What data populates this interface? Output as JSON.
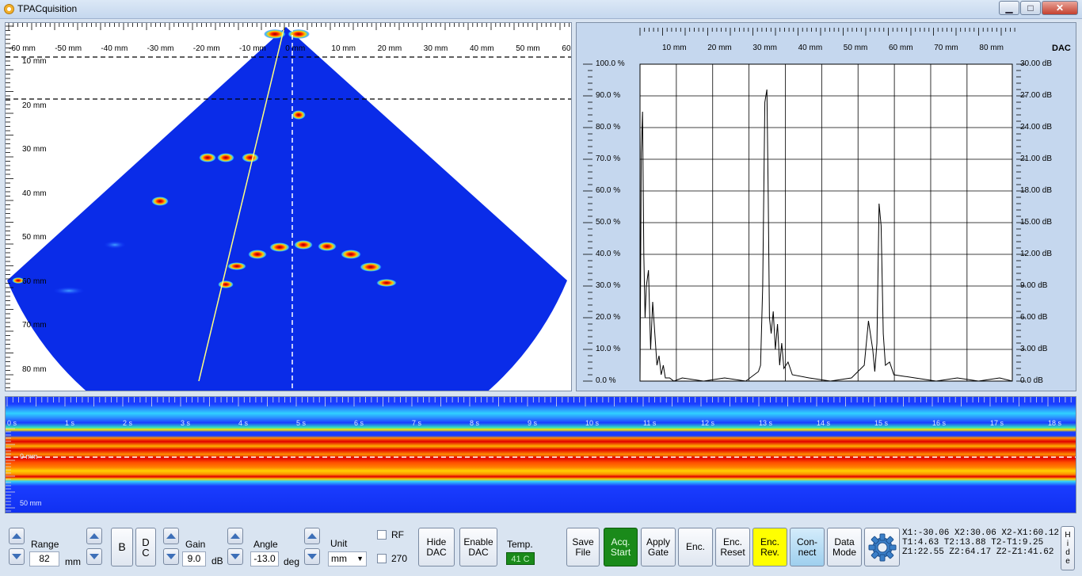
{
  "window": {
    "title": "TPACquisition",
    "minimize": "▁",
    "maximize": "□",
    "close": "✕",
    "icon": "app-icon"
  },
  "bscan": {
    "top_ticks": [
      "-60 mm",
      "-50 mm",
      "-40 mm",
      "-30 mm",
      "-20 mm",
      "-10 mm",
      "0 mm",
      "10 mm",
      "20 mm",
      "30 mm",
      "40 mm",
      "50 mm",
      "60 mm"
    ],
    "depth_ticks": [
      "10 mm",
      "20 mm",
      "30 mm",
      "40 mm",
      "50 mm",
      "60 mm",
      "70 mm",
      "80 mm"
    ]
  },
  "ascan": {
    "top_ticks": [
      "10 mm",
      "20 mm",
      "30 mm",
      "40 mm",
      "50 mm",
      "60 mm",
      "70 mm",
      "80 mm"
    ],
    "left_ticks": [
      "100.0 %",
      "90.0 %",
      "80.0 %",
      "70.0 %",
      "60.0 %",
      "50.0 %",
      "40.0 %",
      "30.0 %",
      "20.0 %",
      "10.0 %",
      "0.0 %"
    ],
    "right_ticks": [
      "30.00 dB",
      "27.00 dB",
      "24.00 dB",
      "21.00 dB",
      "18.00 dB",
      "15.00 dB",
      "12.00 dB",
      "9.00 dB",
      "6.00 dB",
      "3.00 dB",
      "0.0 dB"
    ],
    "dac_label": "DAC"
  },
  "chart_data": {
    "type": "line",
    "xlabel": "",
    "ylabel": "",
    "xlim": [
      0,
      88
    ],
    "ylim": [
      0,
      100
    ],
    "grid": true,
    "series": [
      {
        "x": [
          0,
          0.3,
          0.6,
          0.9,
          1.2,
          1.5,
          2,
          2.5,
          3,
          3.5,
          4,
          4.5,
          5,
          5.5,
          6,
          7,
          8,
          10,
          15,
          20,
          25,
          28,
          28.5,
          29,
          29.5,
          30,
          30.3,
          30.6,
          31,
          31.5,
          32,
          32.5,
          33,
          33.5,
          34,
          35,
          36,
          40,
          45,
          50,
          53,
          54,
          55,
          55.5,
          56,
          56.5,
          57,
          57.5,
          58,
          59,
          60,
          65,
          70,
          75,
          80,
          85,
          88
        ],
        "y": [
          0,
          72,
          85,
          40,
          20,
          30,
          35,
          10,
          25,
          15,
          5,
          8,
          2,
          5,
          1,
          1,
          0,
          1,
          0,
          1,
          0,
          3,
          5,
          30,
          88,
          92,
          60,
          20,
          15,
          22,
          10,
          18,
          5,
          12,
          4,
          6,
          2,
          1,
          0,
          1,
          5,
          19,
          10,
          3,
          12,
          56,
          49,
          15,
          5,
          6,
          2,
          1,
          0,
          1,
          0,
          1,
          0
        ]
      }
    ]
  },
  "cscan": {
    "time_ticks": [
      "0 s",
      "1 s",
      "2 s",
      "3 s",
      "4 s",
      "5 s",
      "6 s",
      "7 s",
      "8 s",
      "9 s",
      "10 s",
      "11 s",
      "12 s",
      "13 s",
      "14 s",
      "15 s",
      "16 s",
      "17 s",
      "18 s"
    ],
    "depth_ticks": [
      "0 mm",
      "50 mm"
    ]
  },
  "controls": {
    "range": {
      "label": "Range",
      "value": "82",
      "unit": "mm"
    },
    "b_label": "B",
    "dc_label": "D\nC",
    "gain": {
      "label": "Gain",
      "value": "9.0",
      "unit": "dB"
    },
    "angle": {
      "label": "Angle",
      "value": "-13.0",
      "unit": "deg"
    },
    "unit": {
      "label": "Unit",
      "value": "mm"
    },
    "rf_label": "RF",
    "deg270_label": "270",
    "hide_dac": "Hide\nDAC",
    "enable_dac": "Enable\nDAC",
    "temp_label": "Temp.",
    "temp_value": "41 C",
    "save_file": "Save\nFile",
    "acq_start": "Acq.\nStart",
    "apply_gate": "Apply\nGate",
    "enc": "Enc.",
    "enc_reset": "Enc.\nReset",
    "enc_rev": "Enc.\nRev.",
    "connect": "Con-\nnect",
    "data_mode": "Data\nMode",
    "hide": "H\ni\nd\ne",
    "settings_icon": "gear-icon",
    "colors": {
      "acq": "#1a8a1a",
      "enc_rev": "#ffff00",
      "connect": "#a8d4f0",
      "temp_bg": "#1a8a1a"
    }
  },
  "status": {
    "line1": "X1:-30.06 X2:30.06 X2-X1:60.12",
    "line2": "T1:4.63 T2:13.88 T2-T1:9.25",
    "line3": "Z1:22.55 Z2:64.17 Z2-Z1:41.62"
  }
}
